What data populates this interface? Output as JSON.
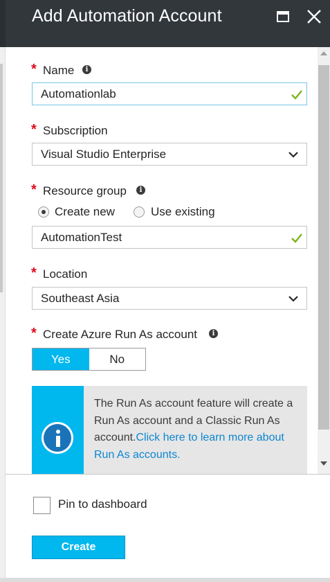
{
  "header": {
    "title": "Add Automation Account"
  },
  "form": {
    "name": {
      "label": "Name",
      "value": "Automationlab",
      "valid": true
    },
    "subscription": {
      "label": "Subscription",
      "value": "Visual Studio Enterprise"
    },
    "resource_group": {
      "label": "Resource group",
      "option_new": "Create new",
      "option_existing": "Use existing",
      "selected": "Create new",
      "value": "AutomationTest",
      "valid": true
    },
    "location": {
      "label": "Location",
      "value": "Southeast Asia"
    },
    "run_as": {
      "label": "Create Azure Run As account",
      "yes": "Yes",
      "no": "No",
      "selected": "Yes"
    }
  },
  "info_box": {
    "text": "The Run As account feature will create a Run As account and a Classic Run As account.",
    "link": "Click here to learn more about Run As accounts."
  },
  "footer": {
    "pin_label": "Pin to dashboard",
    "pin_checked": false,
    "create_label": "Create"
  },
  "colors": {
    "header_bg": "#32373c",
    "accent": "#00b7ee",
    "required": "#e00b1c",
    "link": "#0c86d1",
    "valid": "#7ab51d"
  },
  "icons": [
    "maximize-icon",
    "close-icon",
    "info-icon",
    "checkmark-icon",
    "chevron-down-icon"
  ]
}
